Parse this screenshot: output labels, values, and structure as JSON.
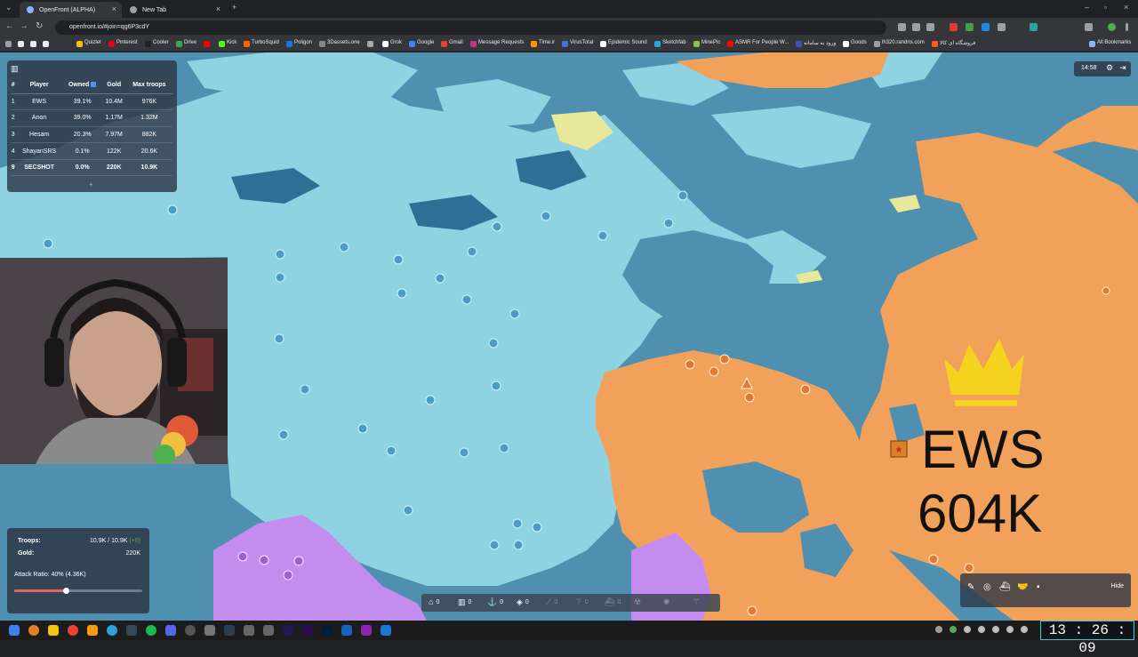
{
  "browser": {
    "tabs": [
      {
        "title": "OpenFront (ALPHA)",
        "active": true
      },
      {
        "title": "New Tab",
        "active": false
      }
    ],
    "url": "openfront.io/#join=qg6P3cdY",
    "bookmarks": [
      {
        "label": "Quizlet",
        "color": "#f4c20d"
      },
      {
        "label": "Pinterest",
        "color": "#e60023"
      },
      {
        "label": "Cooler",
        "color": "#222222"
      },
      {
        "label": "Drive",
        "color": "#34a853"
      },
      {
        "label": "",
        "color": "#ff0000"
      },
      {
        "label": "Kick",
        "color": "#53fc18"
      },
      {
        "label": "TurboSquid",
        "color": "#ff6600"
      },
      {
        "label": "Poligon",
        "color": "#1a73e8"
      },
      {
        "label": "3Dassets.one",
        "color": "#888888"
      },
      {
        "label": "",
        "color": "#aaaaaa"
      },
      {
        "label": "Grok",
        "color": "#ffffff"
      },
      {
        "label": "Google",
        "color": "#4285f4"
      },
      {
        "label": "Gmail",
        "color": "#ea4335"
      },
      {
        "label": "Message Requests",
        "color": "#c13584"
      },
      {
        "label": "Time.ir",
        "color": "#ff9800"
      },
      {
        "label": "VirusTotal",
        "color": "#3c78d8"
      },
      {
        "label": "Epidemic Sound",
        "color": "#ffffff"
      },
      {
        "label": "Sketchfab",
        "color": "#1caad9"
      },
      {
        "label": "MinePic",
        "color": "#8bc34a"
      },
      {
        "label": "ASMR For People W...",
        "color": "#ff0000"
      },
      {
        "label": "ورود به سامانه",
        "color": "#3f51b5"
      },
      {
        "label": "Goods",
        "color": "#ffffff"
      },
      {
        "label": "lh320.randns.com",
        "color": "#9e9e9e"
      },
      {
        "label": "فروشگاه ای کالا",
        "color": "#ff5722"
      }
    ],
    "all_bookmarks_label": "All Bookmarks"
  },
  "leaderboard": {
    "columns": [
      "#",
      "Player",
      "Owned",
      "Gold",
      "Max troops"
    ],
    "rows": [
      {
        "rank": "1",
        "player": "EWS",
        "owned": "39.1%",
        "gold": "10.4M",
        "max_troops": "976K"
      },
      {
        "rank": "2",
        "player": "Anon",
        "owned": "39.0%",
        "gold": "1.17M",
        "max_troops": "1.32M"
      },
      {
        "rank": "3",
        "player": "Hesam",
        "owned": "20.3%",
        "gold": "7.97M",
        "max_troops": "882K"
      },
      {
        "rank": "4",
        "player": "ShayanSRS",
        "owned": "0.1%",
        "gold": "122K",
        "max_troops": "20.6K"
      },
      {
        "rank": "9",
        "player": "SECSHOT",
        "owned": "0.0%",
        "gold": "220K",
        "max_troops": "10.9K"
      }
    ],
    "more": "+"
  },
  "stats": {
    "troops_label": "Troops:",
    "troops_value": "10.9K / 10.9K",
    "troops_delta": "(+0)",
    "gold_label": "Gold:",
    "gold_value": "220K",
    "attack_ratio_label": "Attack Ratio: 40% (4.36K)",
    "attack_ratio": 0.4
  },
  "timer": "14:58",
  "buildbar": {
    "items": [
      {
        "icon": "city-icon",
        "count": "0",
        "dim": false
      },
      {
        "icon": "factory-icon",
        "count": "0",
        "dim": false
      },
      {
        "icon": "port-icon",
        "count": "0",
        "dim": false
      },
      {
        "icon": "defense-post-icon",
        "count": "0",
        "dim": false
      },
      {
        "icon": "missile-silo-icon",
        "count": "0",
        "dim": true
      },
      {
        "icon": "sam-launcher-icon",
        "count": "0",
        "dim": true
      },
      {
        "icon": "warship-icon",
        "count": "0",
        "dim": true
      },
      {
        "icon": "atom-bomb-icon",
        "count": "",
        "dim": true
      },
      {
        "icon": "hydrogen-bomb-icon",
        "count": "",
        "dim": true
      },
      {
        "icon": "mirv-icon",
        "count": "",
        "dim": true
      }
    ]
  },
  "emoji_panel": {
    "hide_label": "Hide"
  },
  "map_label": {
    "player": "EWS",
    "troops": "604K"
  },
  "colors": {
    "water": "#4f8fb0",
    "light_land": "#8fd3e3",
    "ews": "#f2a15a",
    "hesam": "#c58cf0",
    "accent": "#5b8def"
  },
  "clock": "13 : 26 : 09"
}
